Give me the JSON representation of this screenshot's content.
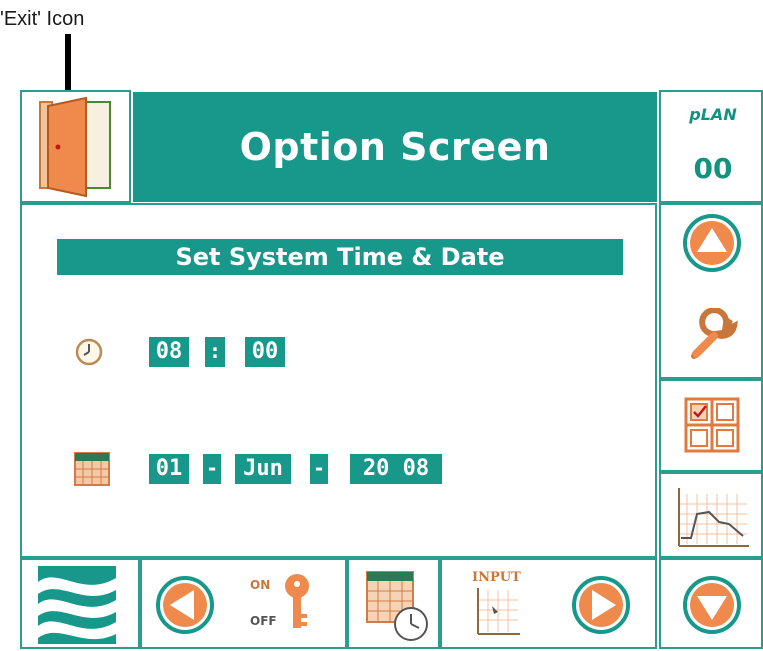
{
  "annotation": {
    "text": "'Exit' Icon"
  },
  "header": {
    "title": "Option Screen",
    "plan_label": "pLAN",
    "plan_value": "00"
  },
  "section": {
    "title": "Set System Time & Date"
  },
  "time": {
    "hours": "08",
    "separator": ":",
    "minutes": "00"
  },
  "date": {
    "day": "01",
    "separator": "-",
    "month": "Jun",
    "year": "20 08"
  },
  "bottom_bar": {
    "onoff_on": "ON",
    "onoff_off": "OFF",
    "input_label": "INPUT"
  },
  "colors": {
    "teal": "#17988a",
    "orange": "#ef8a4c",
    "border": "#2a9d8f"
  },
  "icons": {
    "exit": "door-icon",
    "clock": "clock-icon",
    "calendar": "calendar-icon",
    "up": "up-arrow-icon",
    "down": "down-arrow-icon",
    "service": "wrench-icon",
    "grid": "grid-checklist-icon",
    "trend": "trend-graph-icon",
    "logo": "waves-logo-icon",
    "prev": "left-arrow-icon",
    "next": "right-arrow-icon",
    "onoff": "on-off-key-icon",
    "scheduler": "calendar-clock-icon",
    "inputs": "input-graph-icon"
  }
}
